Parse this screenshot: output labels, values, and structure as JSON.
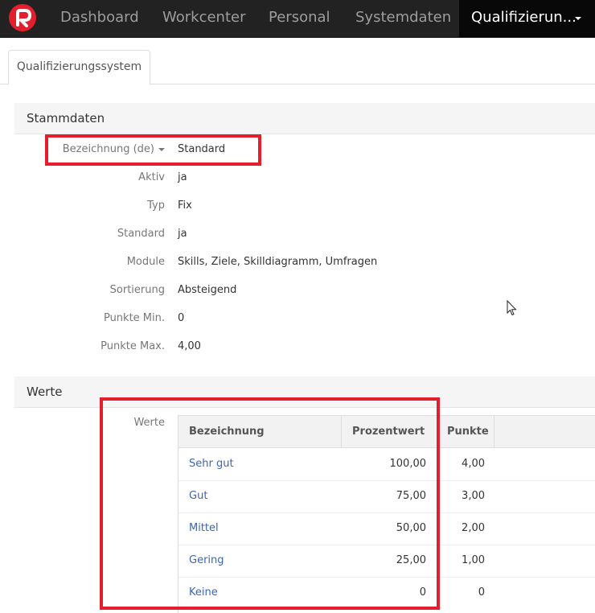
{
  "nav": {
    "items": [
      "Dashboard",
      "Workcenter",
      "Personal",
      "Systemdaten"
    ],
    "active": "Qualifizierun..."
  },
  "tab": {
    "label": "Qualifizierungssystem"
  },
  "stammdaten": {
    "title": "Stammdaten",
    "rows": [
      {
        "label": "Bezeichnung (de)",
        "value": "Standard"
      },
      {
        "label": "Aktiv",
        "value": "ja"
      },
      {
        "label": "Typ",
        "value": "Fix"
      },
      {
        "label": "Standard",
        "value": "ja"
      },
      {
        "label": "Module",
        "value": "Skills, Ziele, Skilldiagramm, Umfragen"
      },
      {
        "label": "Sortierung",
        "value": "Absteigend"
      },
      {
        "label": "Punkte Min.",
        "value": "0"
      },
      {
        "label": "Punkte Max.",
        "value": "4,00"
      }
    ]
  },
  "werte": {
    "title": "Werte",
    "field_label": "Werte",
    "columns": [
      "Bezeichnung",
      "Prozentwert",
      "Punkte"
    ],
    "rows": [
      {
        "name": "Sehr gut",
        "percent": "100,00",
        "points": "4,00"
      },
      {
        "name": "Gut",
        "percent": "75,00",
        "points": "3,00"
      },
      {
        "name": "Mittel",
        "percent": "50,00",
        "points": "2,00"
      },
      {
        "name": "Gering",
        "percent": "25,00",
        "points": "1,00"
      },
      {
        "name": "Keine",
        "percent": "0",
        "points": "0"
      }
    ]
  },
  "colors": {
    "accent": "#e31e2d",
    "link": "#3b65b5",
    "navbar": "#222222"
  }
}
